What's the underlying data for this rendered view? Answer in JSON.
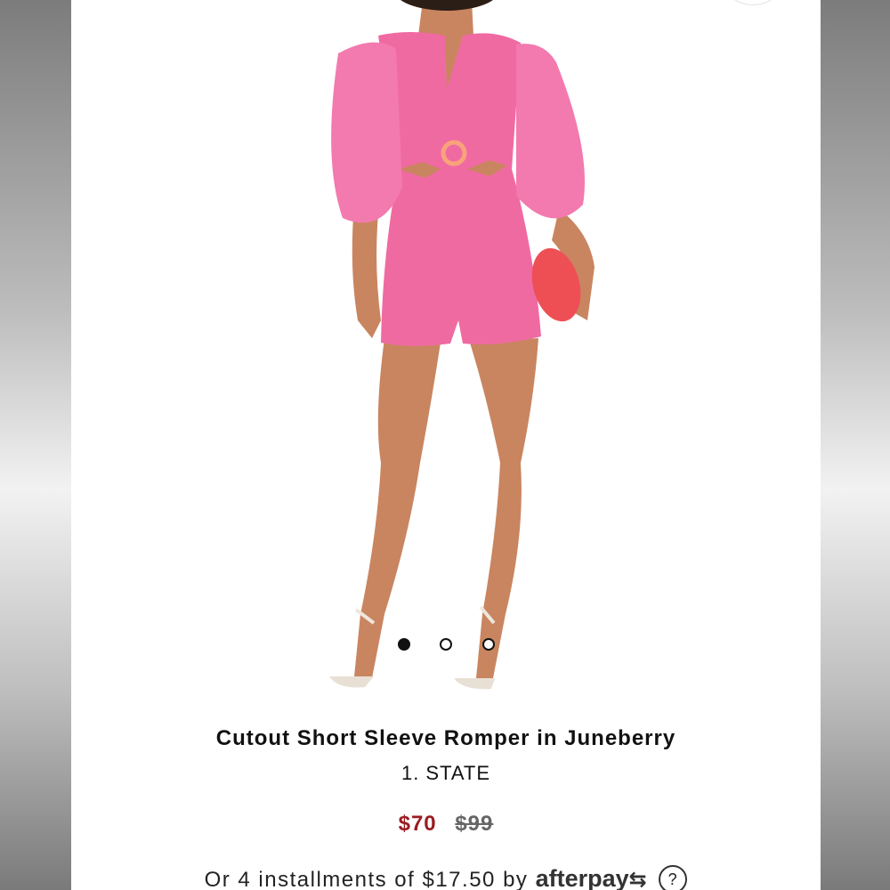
{
  "product": {
    "title": "Cutout Short Sleeve Romper in Juneberry",
    "brand": "1. STATE",
    "price_sale": "$70",
    "price_original": "$99",
    "image_alt": "Model wearing pink cutout short sleeve romper holding a coral clutch"
  },
  "carousel": {
    "total": 3,
    "active_index": 0
  },
  "afterpay": {
    "text": "Or 4 installments of $17.50 by",
    "logo": "afterpay",
    "logo_icon": "afterpay-arrows-icon",
    "help_icon": "question-circle-icon",
    "help_glyph": "?"
  },
  "colors": {
    "romper_pink": "#f06aa2",
    "sale_price": "#9b1c22",
    "clutch": "#ee4f55",
    "skin": "#c98560"
  }
}
